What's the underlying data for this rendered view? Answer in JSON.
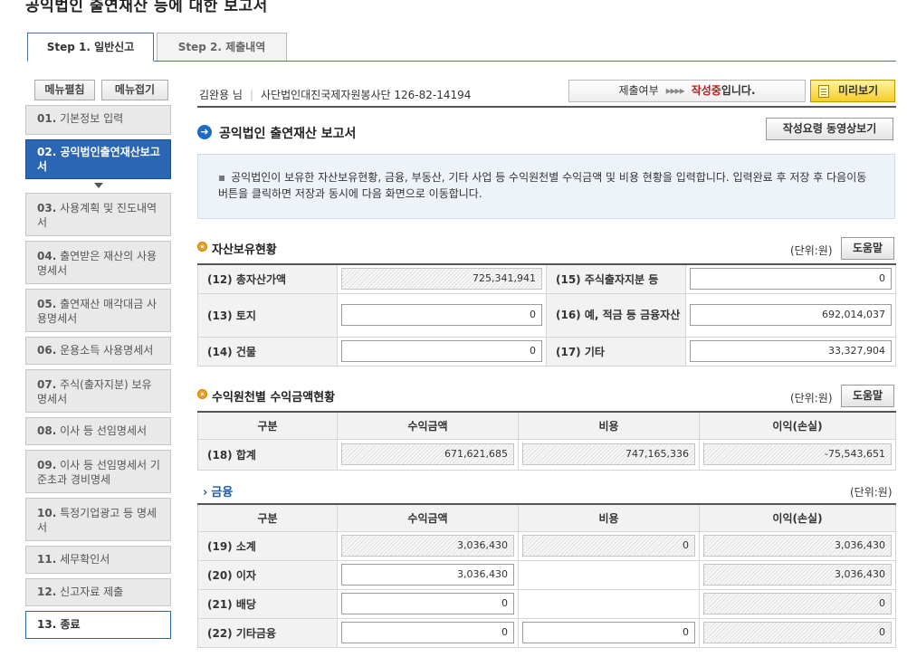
{
  "page_title": "공익법인 출연재산 등에 대한 보고서",
  "tabs": [
    {
      "label": "Step 1. 일반신고"
    },
    {
      "label": "Step 2. 제출내역"
    }
  ],
  "menu_buttons": {
    "expand": "메뉴펼침",
    "collapse": "메뉴접기"
  },
  "sidebar": {
    "items": [
      {
        "num": "01.",
        "label": "기본정보 입력"
      },
      {
        "num": "02.",
        "label": "공익법인출연재산보고서"
      },
      {
        "num": "03.",
        "label": "사용계획 및 진도내역서"
      },
      {
        "num": "04.",
        "label": "출연받은 재산의 사용명세서"
      },
      {
        "num": "05.",
        "label": "출연재산 매각대금 사용명세서"
      },
      {
        "num": "06.",
        "label": "운용소득 사용명세서"
      },
      {
        "num": "07.",
        "label": "주식(출자지분) 보유명세서"
      },
      {
        "num": "08.",
        "label": "이사 등 선임명세서"
      },
      {
        "num": "09.",
        "label": "이사 등 선임명세서 기준초과 경비명세"
      },
      {
        "num": "10.",
        "label": "특정기업광고 등 명세서"
      },
      {
        "num": "11.",
        "label": "세무확인서"
      },
      {
        "num": "12.",
        "label": "신고자료 제출"
      },
      {
        "num": "13.",
        "label": "종료"
      }
    ]
  },
  "user_bar": {
    "user_name": "김완용 님",
    "org": "사단법인대진국제자원봉사단 126-82-14194",
    "status_label": "제출여부",
    "status_arrows": "▸▸▸▸",
    "status_value": "작성중",
    "status_tail": "입니다.",
    "preview": "미리보기"
  },
  "section": {
    "title": "공익법인 출연재산 보고서",
    "video_button": "작성요령 동영상보기",
    "notice": "공익법인이 보유한 자산보유현황, 금융, 부동산, 기타 사업 등 수익원천별 수익금액 및 비용 현황을 입력합니다. 입력완료 후 저장 후 다음이동 버튼을 클릭하면 저장과 동시에 다음 화면으로 이동합니다."
  },
  "unit_label": "(단위:원)",
  "help_label": "도움말",
  "assets": {
    "title": "자산보유현황",
    "rows": [
      {
        "left_label": "(12) 총자산가액",
        "left_value": "725,341,941",
        "right_label": "(15) 주식출자지분 등",
        "right_value": "0"
      },
      {
        "left_label": "(13) 토지",
        "left_value": "0",
        "right_label": "(16) 예, 적금 등 금융자산",
        "right_value": "692,014,037"
      },
      {
        "left_label": "(14) 건물",
        "left_value": "0",
        "right_label": "(17) 기타",
        "right_value": "33,327,904"
      }
    ]
  },
  "income": {
    "title": "수익원천별 수익금액현황",
    "headers": [
      "구분",
      "수익금액",
      "비용",
      "이익(손실)"
    ],
    "total": {
      "label": "(18) 합계",
      "revenue": "671,621,685",
      "cost": "747,165,336",
      "profit": "-75,543,651"
    }
  },
  "finance": {
    "title": "금융",
    "headers": [
      "구분",
      "수익금액",
      "비용",
      "이익(손실)"
    ],
    "rows": [
      {
        "label": "(19) 소계",
        "revenue": "3,036,430",
        "cost": "0",
        "profit": "3,036,430"
      },
      {
        "label": "(20) 이자",
        "revenue": "3,036,430",
        "cost": "",
        "profit": "3,036,430"
      },
      {
        "label": "(21) 배당",
        "revenue": "0",
        "cost": "",
        "profit": "0"
      },
      {
        "label": "(22) 기타금융",
        "revenue": "0",
        "cost": "0",
        "profit": "0"
      }
    ]
  }
}
